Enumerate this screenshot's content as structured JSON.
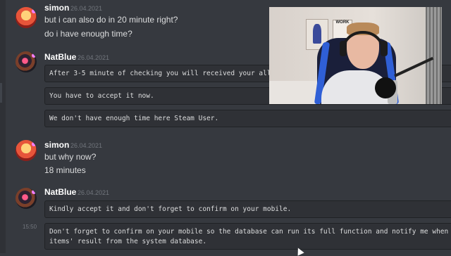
{
  "messages": [
    {
      "username": "simon",
      "timestamp": "26.04.2021",
      "lines": [
        "but i can also do in 20 minute right?",
        "do i have enough time?"
      ]
    },
    {
      "username": "NatBlue",
      "timestamp": "26.04.2021",
      "code": [
        "After 3-5 minute of checking you will received your all",
        "You have to accept it now.",
        " We don't have enough time here Steam User."
      ]
    },
    {
      "username": "simon",
      "timestamp": "26.04.2021",
      "lines": [
        "but why now?",
        "18 minutes"
      ]
    },
    {
      "username": "NatBlue",
      "timestamp": "26.04.2021",
      "code": [
        "Kindly accept it and don't forget to confirm on your mobile.",
        "Don't forget to confirm on your mobile so the database can run its full function and notify me when items' result from the system database."
      ],
      "gutter_time": "15:50"
    }
  ],
  "webcam": {
    "poster_text": "WORK"
  },
  "colors": {
    "background": "#36393f",
    "codeblock": "#2f3136",
    "username": "#ffffff",
    "timestamp": "#72767d",
    "text": "#dcddde"
  }
}
